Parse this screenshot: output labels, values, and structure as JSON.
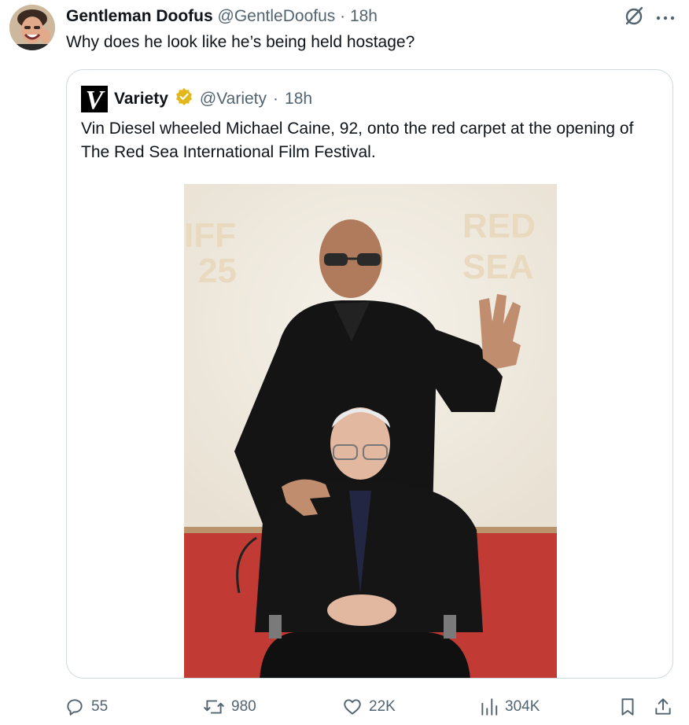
{
  "post": {
    "author_name": "Gentleman Doofus",
    "handle": "@GentleDoofus",
    "separator": "·",
    "time": "18h",
    "text": "Why does he look like he’s being held hostage?"
  },
  "quoted": {
    "author_name": "Variety",
    "logo_letter": "V",
    "handle": "@Variety",
    "separator": "·",
    "time": "18h",
    "verified": true,
    "text": "Vin Diesel wheeled Michael Caine, 92, onto the red carpet at the opening of The Red Sea International Film Festival.",
    "photo_backdrop_text": {
      "left_line1": "IFF",
      "left_line2": "25",
      "right_line1": "RED",
      "right_line2": "SEA"
    }
  },
  "actions": {
    "replies": "55",
    "reposts": "980",
    "likes": "22K",
    "views": "304K"
  },
  "icons": {
    "avatar": "avatar",
    "grok": "slashed-circle-icon",
    "more": "more-icon",
    "reply": "reply-icon",
    "repost": "repost-icon",
    "like": "heart-icon",
    "views": "bar-chart-icon",
    "bookmark": "bookmark-icon",
    "share": "share-icon"
  },
  "colors": {
    "text": "#0f1419",
    "muted": "#536471",
    "border": "#cfd9de",
    "verified_gold": "#e2b719",
    "carpet": "#c23a34"
  }
}
